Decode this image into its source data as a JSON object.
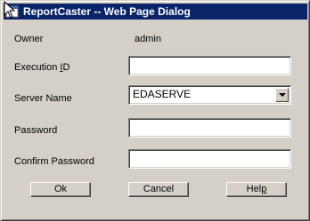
{
  "window": {
    "title": "ReportCaster -- Web Page Dialog",
    "icon": "app-window-icon",
    "titlebar_color": "#0a246a"
  },
  "form": {
    "owner_label": "Owner",
    "owner_value": "admin",
    "execution_id_label_pre": "Execution ",
    "execution_id_label_accel": "I",
    "execution_id_label_post": "D",
    "execution_id_value": "",
    "server_name_label": "Server Name",
    "server_name_value": "EDASERVE",
    "password_label": "Password",
    "password_value": "",
    "confirm_password_label": "Confirm Password",
    "confirm_password_value": ""
  },
  "buttons": {
    "ok": "Ok",
    "cancel": "Cancel",
    "help_pre": "Hel",
    "help_accel": "p"
  }
}
